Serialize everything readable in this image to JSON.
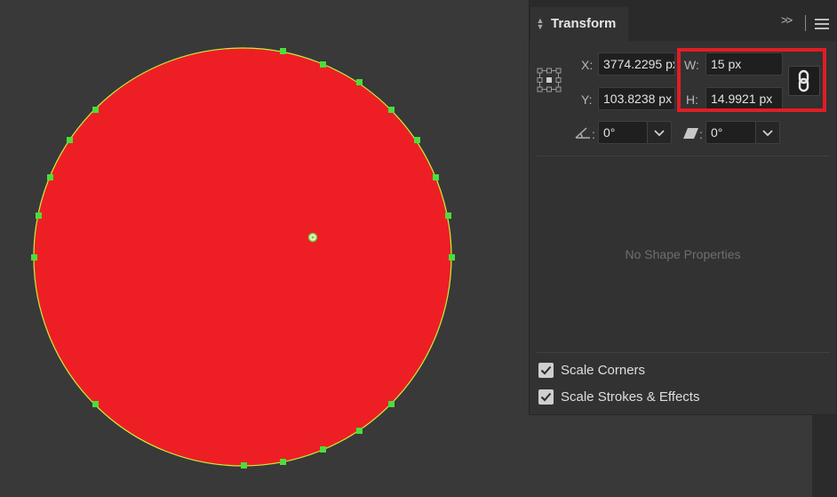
{
  "panel": {
    "title": "Transform",
    "x_label": "X:",
    "x_value": "3774.2295 px",
    "y_label": "Y:",
    "y_value": "103.8238 px",
    "w_label": "W:",
    "w_value": "15 px",
    "h_label": "H:",
    "h_value": "14.9921 px",
    "rotate_value": "0°",
    "shear_value": "0°",
    "colon": ":",
    "no_shape_text": "No Shape Properties",
    "scale_corners_label": "Scale Corners",
    "scale_corners_checked": true,
    "scale_strokes_label": "Scale Strokes & Effects",
    "scale_strokes_checked": true
  },
  "icons": {
    "collapse": "double-chevron-right-icon",
    "menu": "hamburger-menu-icon",
    "reference_point": "reference-point-icon",
    "rotate": "rotate-angle-icon",
    "shear": "shear-icon",
    "constrain": "link-icon",
    "dropdown": "chevron-down-icon"
  },
  "colors": {
    "circle_fill": "#ed1f24",
    "selection_outline": "#c4f03a",
    "anchor_point": "#4ade3b",
    "highlight_box": "#e11d25",
    "canvas_bg": "#393939",
    "panel_bg": "#323232"
  }
}
